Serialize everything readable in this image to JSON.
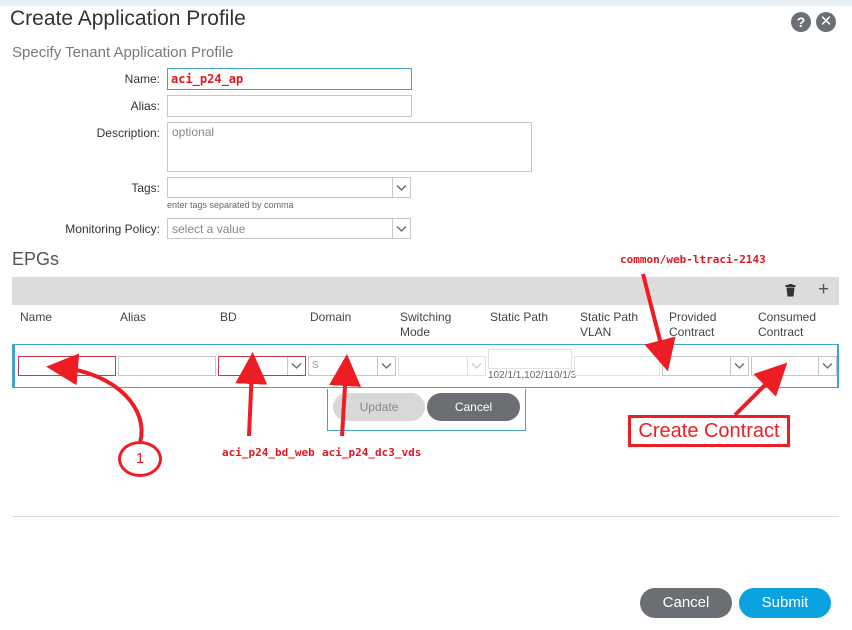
{
  "dialog": {
    "title": "Create Application Profile",
    "subtitle": "Specify Tenant Application Profile",
    "help_glyph": "?",
    "close_glyph": "✕"
  },
  "form": {
    "name_label": "Name:",
    "name_value": "aci_p24_ap",
    "alias_label": "Alias:",
    "alias_value": "",
    "description_label": "Description:",
    "description_placeholder": "optional",
    "tags_label": "Tags:",
    "tags_hint": "enter tags separated by comma",
    "monitoring_label": "Monitoring Policy:",
    "monitoring_placeholder": "select a value"
  },
  "epgs": {
    "heading": "EPGs",
    "toolbar_icons": [
      "trash-icon",
      "plus-icon"
    ],
    "plus_glyph": "+",
    "columns": [
      "Name",
      "Alias",
      "BD",
      "Domain",
      "Switching Mode",
      "Static Path",
      "Static Path VLAN",
      "Provided Contract",
      "Consumed Contract"
    ],
    "row": {
      "domain_partial": "S",
      "static_path_text": "102/1/1,102/110/1/3"
    },
    "update_label": "Update",
    "cancel_label": "Cancel"
  },
  "annotations": {
    "provided_contract_note": "common/web-ltraci-2143",
    "bd_note": "aci_p24_bd_web",
    "domain_note": "aci_p24_dc3_vds",
    "create_contract": "Create Contract",
    "step_number": "1",
    "arrow_color": "#ee1d24"
  },
  "footer": {
    "cancel_label": "Cancel",
    "submit_label": "Submit",
    "cancel_color": "#6b6f74",
    "submit_color": "#0aa3e0"
  }
}
